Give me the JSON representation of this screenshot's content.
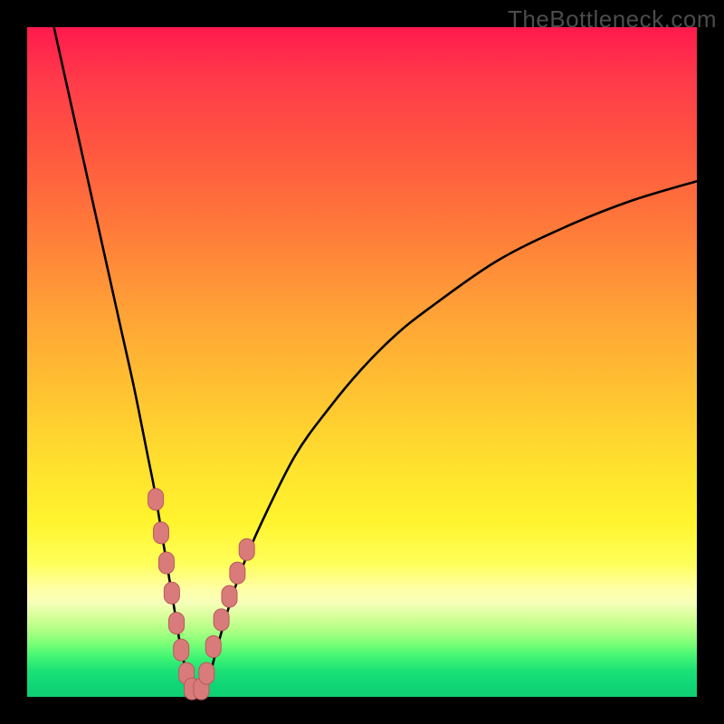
{
  "watermark": "TheBottleneck.com",
  "chart_data": {
    "type": "line",
    "title": "",
    "xlabel": "",
    "ylabel": "",
    "xlim": [
      0,
      100
    ],
    "ylim": [
      0,
      100
    ],
    "grid": false,
    "series": [
      {
        "name": "bottleneck-curve",
        "x": [
          4,
          6,
          8,
          10,
          12,
          14,
          16,
          18,
          19,
          20,
          21,
          22,
          23,
          24,
          25,
          26,
          27,
          28,
          30,
          32,
          35,
          40,
          45,
          50,
          55,
          60,
          70,
          80,
          90,
          100
        ],
        "y": [
          100,
          91,
          82,
          73,
          64,
          55,
          46,
          36,
          31,
          25,
          19,
          13,
          7,
          3,
          0.2,
          0.2,
          2,
          6,
          13,
          19,
          26,
          36,
          43,
          49,
          54,
          58,
          65,
          70,
          74,
          77
        ]
      }
    ],
    "markers": {
      "name": "highlight-points",
      "x": [
        19.2,
        20.0,
        20.8,
        21.6,
        22.3,
        23.0,
        23.8,
        24.6,
        26.0,
        26.8,
        27.8,
        29.0,
        30.2,
        31.4,
        32.8
      ],
      "y": [
        29.5,
        24.5,
        20.0,
        15.5,
        11.0,
        7.0,
        3.5,
        1.2,
        1.2,
        3.5,
        7.5,
        11.5,
        15.0,
        18.5,
        22.0
      ]
    },
    "colors": {
      "curve": "#000000",
      "marker_fill": "#da7b7b",
      "marker_stroke": "#b85a5a"
    }
  }
}
